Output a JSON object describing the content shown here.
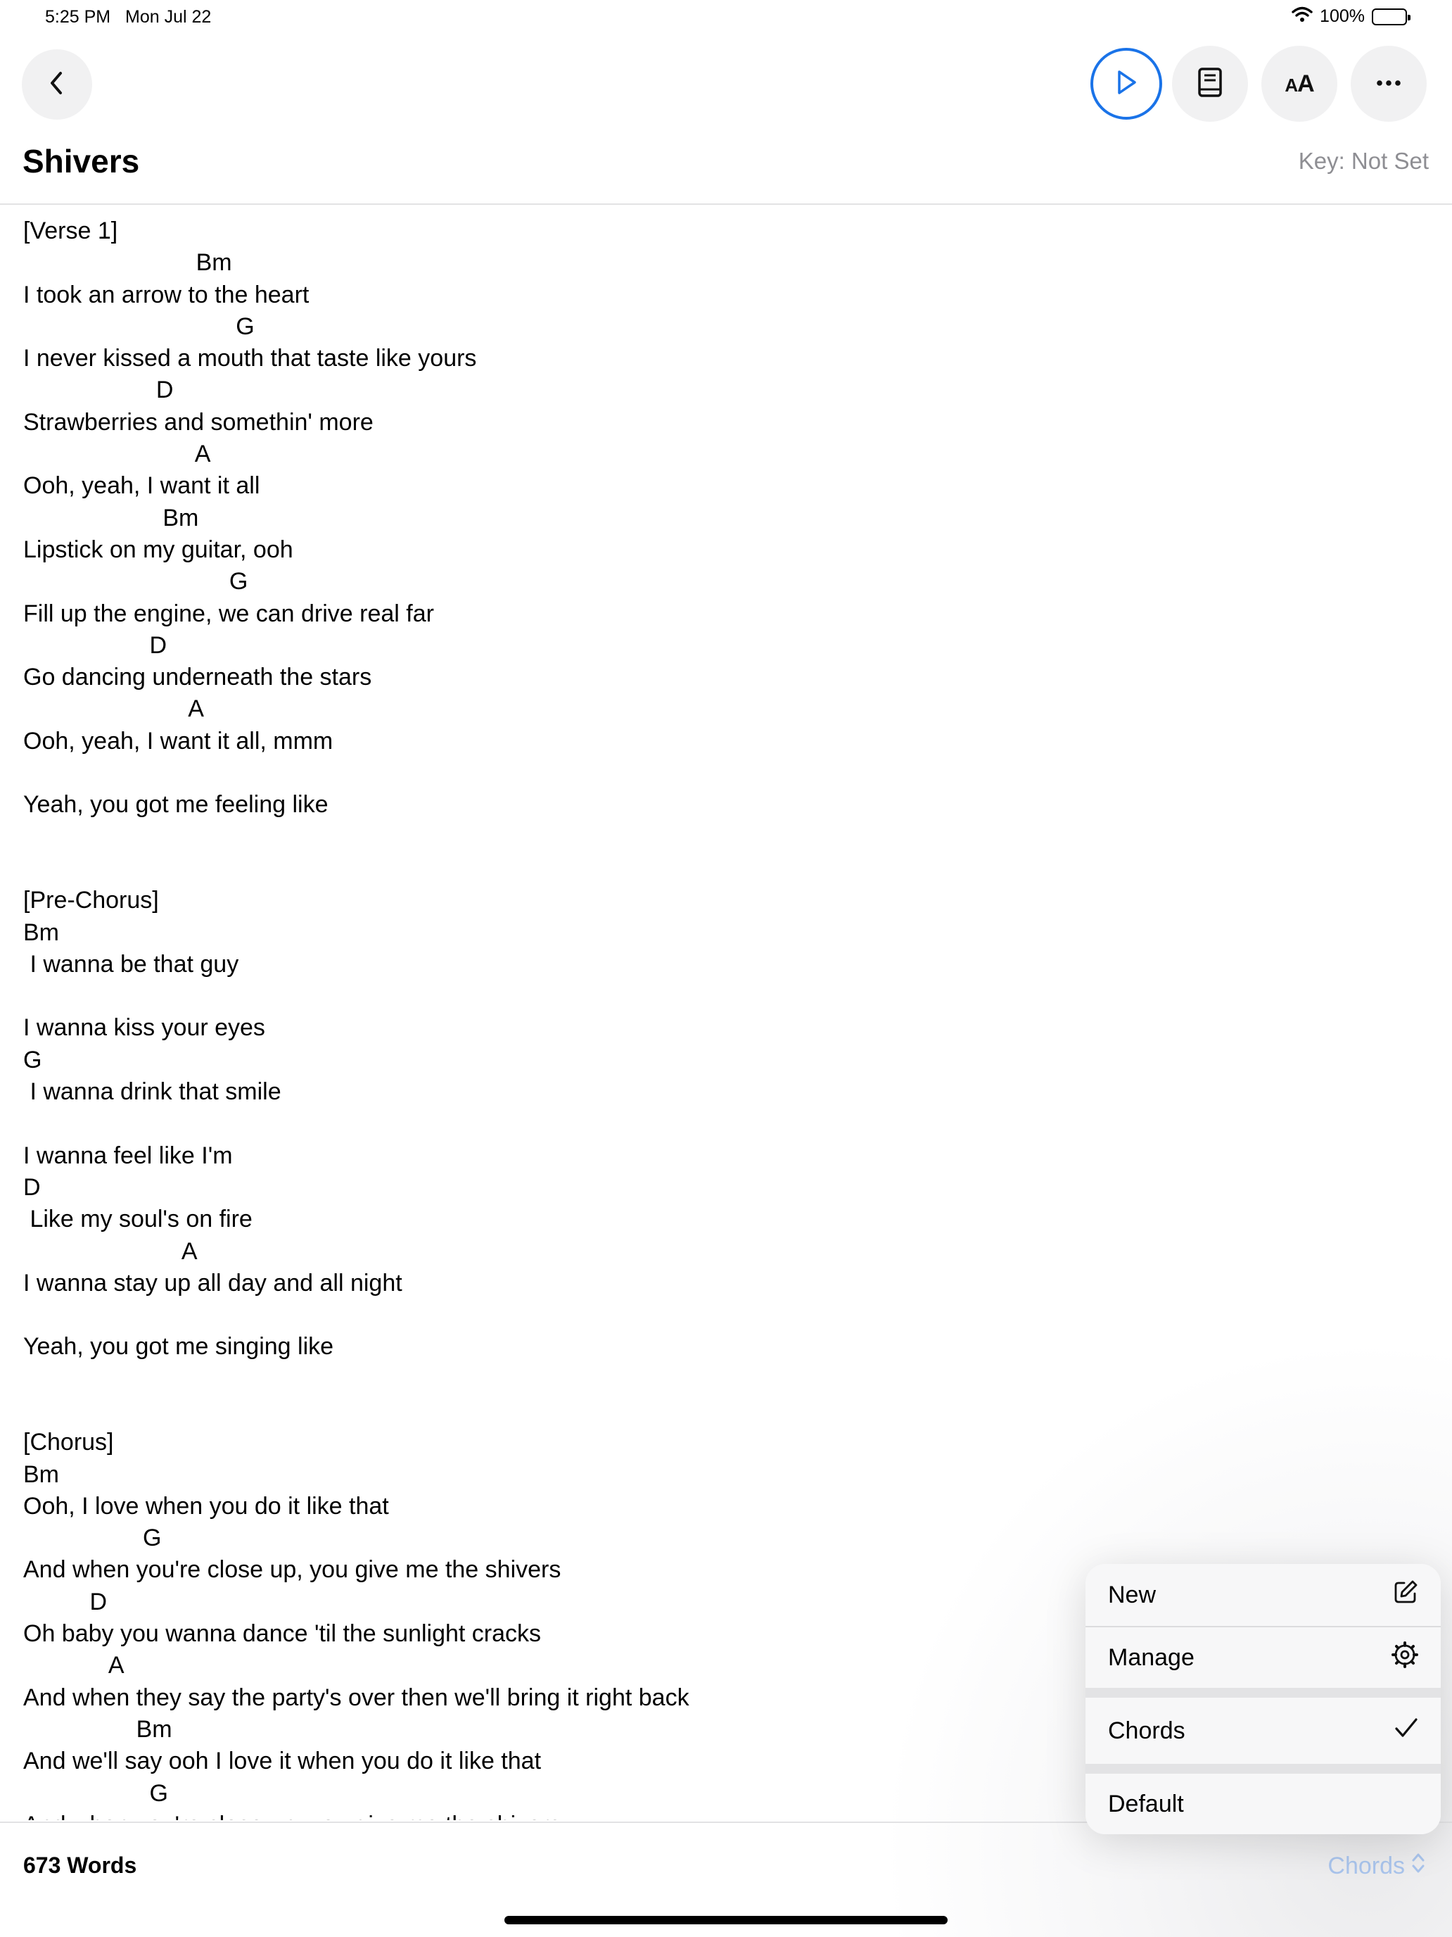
{
  "status_bar": {
    "time": "5:25 PM",
    "date": "Mon Jul 22",
    "battery": "100%"
  },
  "toolbar": {
    "font_size_label_big": "A",
    "font_size_label_small": "A"
  },
  "song": {
    "title": "Shivers",
    "key": "Key: Not Set"
  },
  "lyrics": [
    "[Verse 1]",
    "                          Bm",
    "I took an arrow to the heart",
    "                                G",
    "I never kissed a mouth that taste like yours",
    "                    D",
    "Strawberries and somethin' more",
    "                          A",
    "Ooh, yeah, I want it all",
    "                     Bm",
    "Lipstick on my guitar, ooh",
    "                               G",
    "Fill up the engine, we can drive real far",
    "                   D",
    "Go dancing underneath the stars",
    "                         A",
    "Ooh, yeah, I want it all, mmm",
    "",
    "Yeah, you got me feeling like",
    "",
    "",
    "[Pre-Chorus]",
    "Bm",
    " I wanna be that guy",
    "",
    "I wanna kiss your eyes",
    "G",
    " I wanna drink that smile",
    "",
    "I wanna feel like I'm",
    "D",
    " Like my soul's on fire",
    "                        A",
    "I wanna stay up all day and all night",
    "",
    "Yeah, you got me singing like",
    "",
    "",
    "[Chorus]",
    "Bm",
    "Ooh, I love when you do it like that",
    "                  G",
    "And when you're close up, you give me the shivers",
    "          D",
    "Oh baby you wanna dance 'til the sunlight cracks",
    "             A",
    "And when they say the party's over then we'll bring it right back",
    "                 Bm",
    "And we'll say ooh I love it when you do it like that",
    "                   G",
    "And when you're close up, you give me the shivers"
  ],
  "footer": {
    "word_count": "673 Words",
    "mode_label": "Chords"
  },
  "menu": {
    "new_label": "New",
    "manage_label": "Manage",
    "chords_label": "Chords",
    "default_label": "Default"
  },
  "icons": {
    "back": "chevron-left-icon",
    "play": "play-icon",
    "book": "book-icon",
    "font": "font-size-icon",
    "more": "ellipsis-icon",
    "new": "compose-icon",
    "manage": "gear-icon",
    "chords": "checkmark-icon",
    "mode": "chevron-up-down-icon"
  },
  "colors": {
    "accent": "#1a73e8",
    "muted": "#8e8e93",
    "picker": "#a9c4ec"
  }
}
